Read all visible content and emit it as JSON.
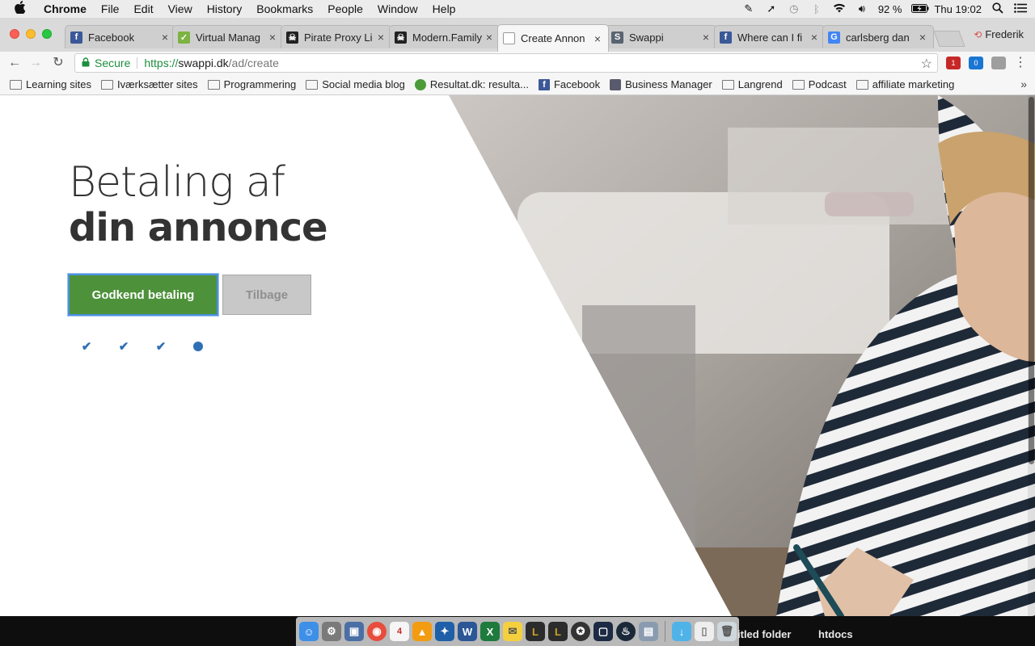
{
  "menubar": {
    "apple": "",
    "items": [
      "Chrome",
      "File",
      "Edit",
      "View",
      "History",
      "Bookmarks",
      "People",
      "Window",
      "Help"
    ],
    "battery": "92 %",
    "clock": "Thu 19:02"
  },
  "tabs": [
    {
      "title": "Facebook",
      "icon": "facebook-icon",
      "color": "#3b5998",
      "glyph": "f"
    },
    {
      "title": "Virtual Manag",
      "icon": "checkmark-favicon",
      "color": "#7cb342",
      "glyph": "✓"
    },
    {
      "title": "Pirate Proxy Li",
      "icon": "pirate-favicon",
      "color": "#222222",
      "glyph": "☠"
    },
    {
      "title": "Modern.Family",
      "icon": "pirate-favicon",
      "color": "#222222",
      "glyph": "☠"
    },
    {
      "title": "Create Annon",
      "icon": "document-favicon",
      "color": "#ffffff",
      "glyph": ""
    },
    {
      "title": "Swappi",
      "icon": "swappi-favicon",
      "color": "#5a6470",
      "glyph": "S"
    },
    {
      "title": "Where can I fi",
      "icon": "facebook-icon",
      "color": "#3b5998",
      "glyph": "f"
    },
    {
      "title": "carlsberg dan",
      "icon": "google-icon",
      "color": "#4285f4",
      "glyph": "G"
    }
  ],
  "profile": "Frederik",
  "omnibox": {
    "secure_label": "Secure",
    "scheme": "https://",
    "host": "swappi.dk",
    "path": "/ad/create"
  },
  "bookmarks": [
    {
      "label": "Learning sites",
      "icon": "folder-icon"
    },
    {
      "label": "Iværksætter sites",
      "icon": "folder-icon"
    },
    {
      "label": "Programmering",
      "icon": "folder-icon"
    },
    {
      "label": "Social media blog",
      "icon": "folder-icon"
    },
    {
      "label": "Resultat.dk: resulta...",
      "icon": "resultat-favicon"
    },
    {
      "label": "Facebook",
      "icon": "facebook-icon"
    },
    {
      "label": "Business Manager",
      "icon": "business-manager-favicon"
    },
    {
      "label": "Langrend",
      "icon": "folder-icon"
    },
    {
      "label": "Podcast",
      "icon": "folder-icon"
    },
    {
      "label": "affiliate marketing",
      "icon": "folder-icon"
    }
  ],
  "page": {
    "heading_line1": "Betaling af",
    "heading_line2": "din annonce",
    "approve_button": "Godkend betaling",
    "back_button": "Tilbage",
    "steps": [
      "done",
      "done",
      "done",
      "current"
    ],
    "accent_color": "#4d913a",
    "step_color": "#2f6fb5"
  },
  "dock": {
    "extension_badges": [
      "1",
      "0"
    ],
    "calendar_day": "4",
    "desktop_labels": [
      "itled folder",
      "htdocs"
    ]
  }
}
